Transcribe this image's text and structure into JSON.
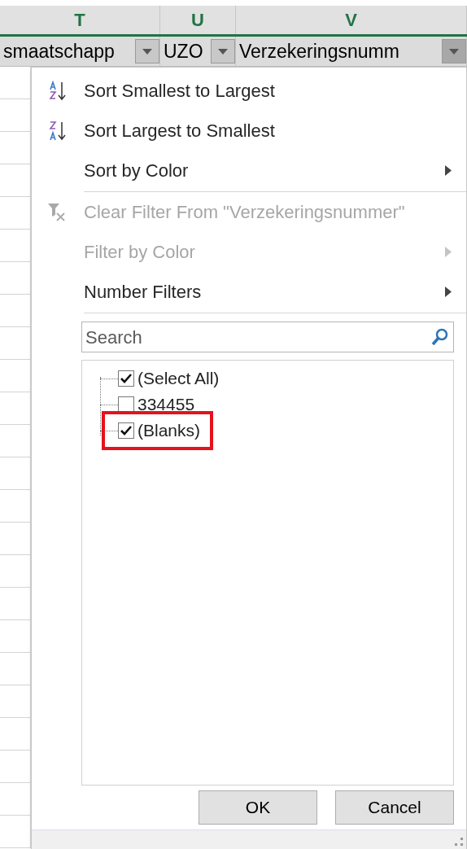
{
  "columns": [
    {
      "letter": "T",
      "header": "smaatschapp",
      "pressed": false
    },
    {
      "letter": "U",
      "header": "UZO",
      "pressed": false
    },
    {
      "letter": "V",
      "header": "Verzekeringsnumm",
      "pressed": true
    }
  ],
  "menu": [
    {
      "kind": "sort_asc",
      "label": "Sort Smallest to Largest",
      "disabled": false,
      "submenu": false
    },
    {
      "kind": "sort_desc",
      "label": "Sort Largest to Smallest",
      "disabled": false,
      "submenu": false
    },
    {
      "kind": "plain",
      "label": "Sort by Color",
      "disabled": false,
      "submenu": true,
      "separator_after": true
    },
    {
      "kind": "clear_filter",
      "label": "Clear Filter From \"Verzekeringsnummer\"",
      "disabled": true,
      "submenu": false
    },
    {
      "kind": "plain",
      "label": "Filter by Color",
      "disabled": true,
      "submenu": true
    },
    {
      "kind": "plain",
      "label": "Number Filters",
      "disabled": false,
      "submenu": true,
      "separator_after": true
    }
  ],
  "search": {
    "placeholder": "Search"
  },
  "values": [
    {
      "label": "(Select All)",
      "checked": true,
      "highlighted": false
    },
    {
      "label": "334455",
      "checked": false,
      "highlighted": false
    },
    {
      "label": "(Blanks)",
      "checked": true,
      "highlighted": true
    }
  ],
  "buttons": [
    "OK",
    "Cancel"
  ]
}
